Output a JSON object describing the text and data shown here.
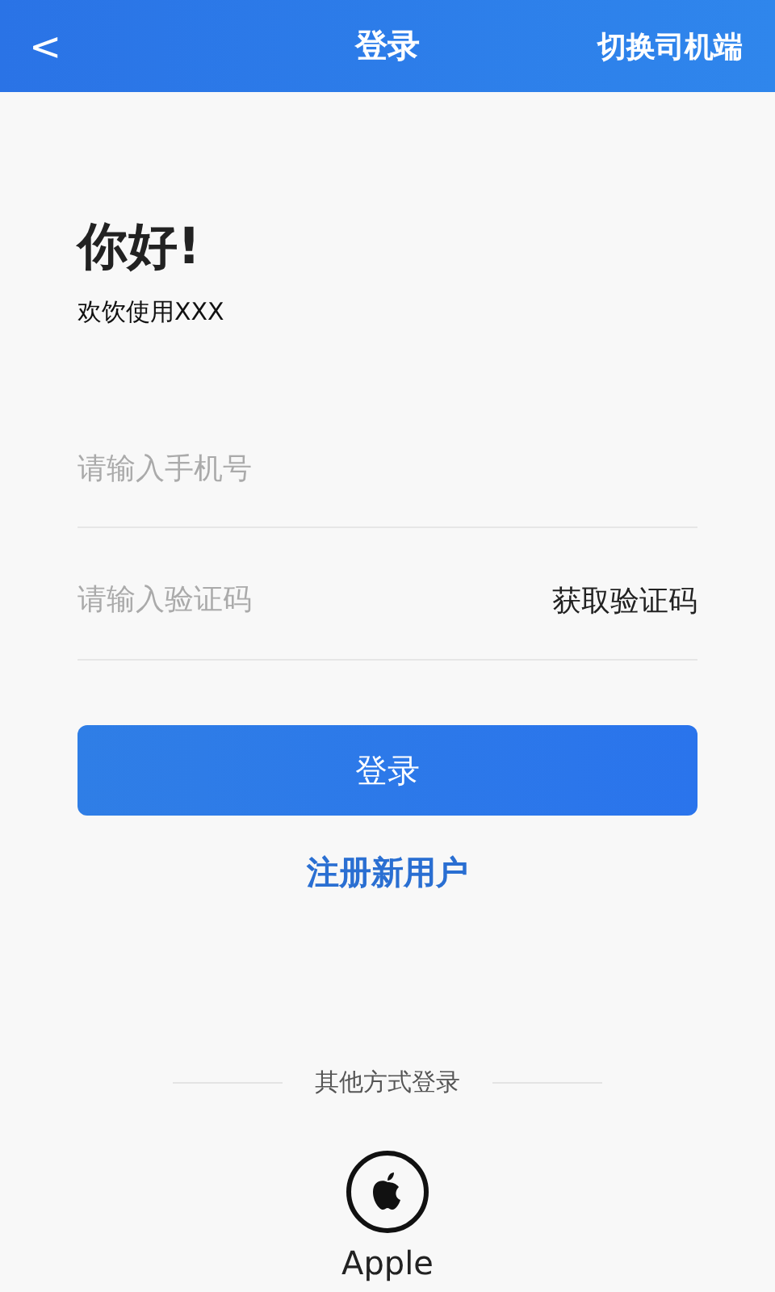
{
  "header": {
    "back": "<",
    "title": "登录",
    "switch_link": "切换司机端"
  },
  "greeting": {
    "title": "你好!",
    "subtitle": "欢饮使用XXX"
  },
  "fields": [
    {
      "kind": "phone",
      "placeholder": "请输入手机号"
    },
    {
      "kind": "code",
      "placeholder": "请输入验证码",
      "action": "获取验证码"
    }
  ],
  "login_button": "登录",
  "register_link": "注册新用户",
  "other_login": {
    "label": "其他方式登录",
    "options": [
      {
        "label": "Apple"
      }
    ]
  }
}
